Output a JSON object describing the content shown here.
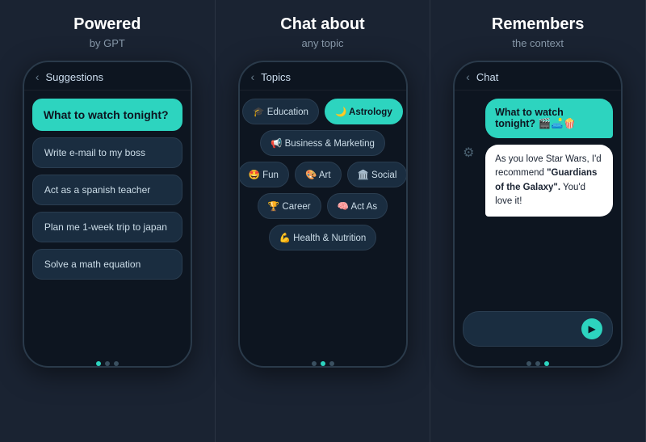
{
  "panel1": {
    "title": "Powered",
    "subtitle1": "by GPT",
    "header": "Suggestions",
    "highlight": "What to watch tonight?",
    "items": [
      "Write e-mail to my boss",
      "Act as a spanish teacher",
      "Plan me 1-week trip to japan",
      "Solve a math equation"
    ],
    "dots": [
      true,
      false,
      false
    ]
  },
  "panel2": {
    "title": "Chat about",
    "subtitle1": "any topic",
    "header": "Topics",
    "rows": [
      [
        {
          "label": "🎓 Education",
          "active": false
        },
        {
          "label": "🌙 Astrology",
          "active": true
        }
      ],
      [
        {
          "label": "📢 Business & Marketing",
          "active": false
        }
      ],
      [
        {
          "label": "🤩 Fun",
          "active": false
        },
        {
          "label": "🎨 Art",
          "active": false
        },
        {
          "label": "🏛️ Social",
          "active": false
        }
      ],
      [
        {
          "label": "🏆 Career",
          "active": false
        },
        {
          "label": "🧠 Act As",
          "active": false
        }
      ],
      [
        {
          "label": "💪 Health & Nutrition",
          "active": false
        }
      ]
    ],
    "dots": [
      false,
      true,
      false
    ]
  },
  "panel3": {
    "title": "Remembers",
    "subtitle1": "the context",
    "header": "Chat",
    "user_message": "What to watch tonight? 🎬🛋️🍿",
    "bot_message_line1": "As you love Star Wars, I'd recommend ",
    "bot_message_bold": "\"Guardians of the Galaxy\".",
    "bot_message_line2": " You'd love it!",
    "input_placeholder": "",
    "dots": [
      false,
      false,
      true
    ]
  },
  "icons": {
    "back": "‹",
    "send": "▶"
  }
}
